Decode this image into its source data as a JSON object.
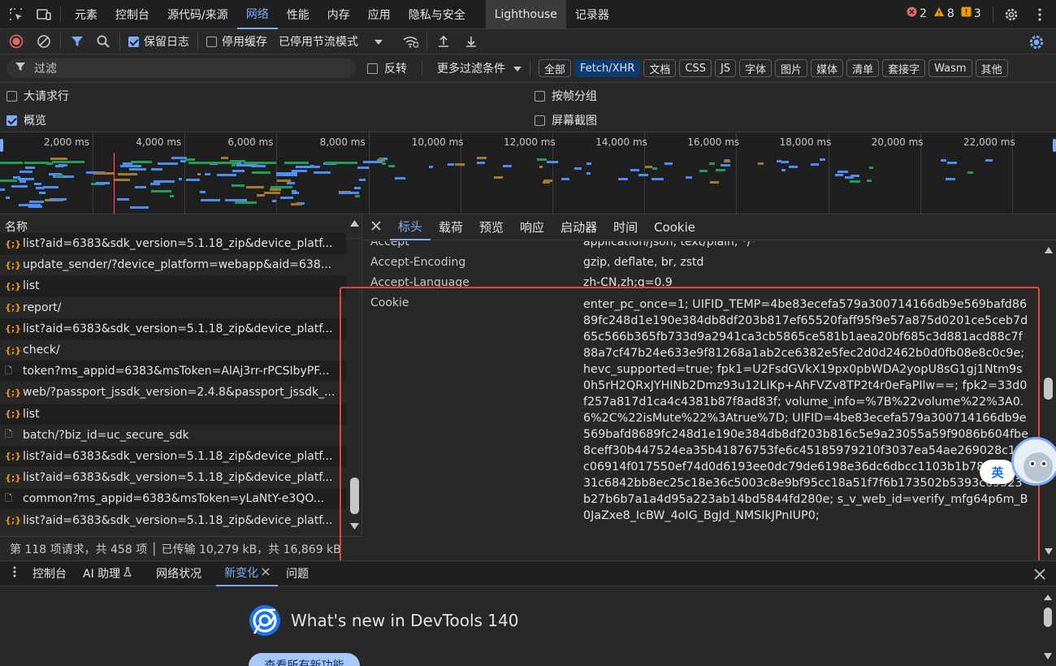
{
  "main_tabs": [
    {
      "label": "元素"
    },
    {
      "label": "控制台"
    },
    {
      "label": "源代码/来源"
    },
    {
      "label": "网络",
      "active": true
    },
    {
      "label": "性能"
    },
    {
      "label": "内存"
    },
    {
      "label": "应用"
    },
    {
      "label": "隐私与安全"
    },
    {
      "label": "Lighthouse"
    },
    {
      "label": "记录器"
    }
  ],
  "badges": {
    "errors": "2",
    "warnings": "8",
    "info": "3"
  },
  "toolbar": {
    "preserve_log": "保留日志",
    "disable_cache": "停用缓存",
    "throttle": "已停用节流模式"
  },
  "filter": {
    "placeholder": "过滤",
    "invert": "反转",
    "more_filters": "更多过滤条件",
    "types": [
      "全部",
      "Fetch/XHR",
      "文档",
      "CSS",
      "JS",
      "字体",
      "图片",
      "媒体",
      "清单",
      "套接字",
      "Wasm",
      "其他"
    ],
    "active_type": "Fetch/XHR"
  },
  "options": {
    "big_rows": "大请求行",
    "overview": "概览",
    "group_by_frame": "按帧分组",
    "screenshots": "屏幕截图"
  },
  "overview": {
    "ticks": [
      "2,000 ms",
      "4,000 ms",
      "6,000 ms",
      "8,000 ms",
      "10,000 ms",
      "12,000 ms",
      "14,000 ms",
      "16,000 ms",
      "18,000 ms",
      "20,000 ms",
      "22,000 ms"
    ]
  },
  "request_list": {
    "header": "名称",
    "rows": [
      {
        "type": "xhr",
        "name": "list?aid=6383&sdk_version=5.1.18_zip&device_platf..."
      },
      {
        "type": "xhr",
        "name": "update_sender/?device_platform=webapp&aid=638..."
      },
      {
        "type": "xhr",
        "name": "list"
      },
      {
        "type": "xhr",
        "name": "report/"
      },
      {
        "type": "xhr",
        "name": "list?aid=6383&sdk_version=5.1.18_zip&device_platf..."
      },
      {
        "type": "xhr",
        "name": "check/"
      },
      {
        "type": "doc",
        "name": "token?ms_appid=6383&msToken=AlAj3rr-rPCSIbyPF..."
      },
      {
        "type": "xhr",
        "name": "web/?passport_jssdk_version=2.4.8&passport_jssdk_..."
      },
      {
        "type": "xhr",
        "name": "list"
      },
      {
        "type": "doc",
        "name": "batch/?biz_id=uc_secure_sdk"
      },
      {
        "type": "xhr",
        "name": "list?aid=6383&sdk_version=5.1.18_zip&device_platf..."
      },
      {
        "type": "xhr",
        "name": "list?aid=6383&sdk_version=5.1.18_zip&device_platf..."
      },
      {
        "type": "doc",
        "name": "common?ms_appid=6383&msToken=yLaNtY-e3QO..."
      },
      {
        "type": "xhr",
        "name": "list?aid=6383&sdk_version=5.1.18_zip&device_platf..."
      }
    ]
  },
  "status_bar": "第 118 项请求，共 458 项 │ 已传输 10,279 kB，共 16,869 kB",
  "details": {
    "tabs": [
      "标头",
      "载荷",
      "预览",
      "响应",
      "启动器",
      "时间",
      "Cookie"
    ],
    "active_tab": "标头",
    "headers": [
      {
        "name": "Accept",
        "value": "application/json, text/plain, */*"
      },
      {
        "name": "Accept-Encoding",
        "value": "gzip, deflate, br, zstd"
      },
      {
        "name": "Accept-Language",
        "value": "zh-CN,zh;q=0.9"
      },
      {
        "name": "Cookie",
        "value": "enter_pc_once=1; UIFID_TEMP=4be83ecefa579a300714166db9e569bafd8689fc248d1e190e384db8df203b817ef65520faff95f9e57a875d0201ce5ceb7d65c566b365fb733d9a2941ca3cb5865ce581b1aea20bf685c3d881acd88c7f88a7cf47b24e633e9f81268a1ab2ce6382e5fec2d0d2462b0d0fb08e8c0c9e; hevc_supported=true; fpk1=U2FsdGVkX19px0pbWDA2yopU8sG1gj1Ntm9s0h5rH2QRxJYHINb2Dmz93u12LIKp+AhFVZv8TP2t4r0eFaPIlw==; fpk2=33d0f257a817d1ca4c4381b87f8ad83f; volume_info=%7B%22volume%22%3A0.6%2C%22isMute%22%3Atrue%7D; UIFID=4be83ecefa579a300714166db9e569bafd8689fc248d1e190e384db8df203b816c5e9a23055a59f9086b604fbe8ceff30b447524ea35b41876753fe6c45185979210f3037ea54ae269028c15c06914f017550ef74d0d6193ee0dc79de6198e36dc6dbcc1103b1b78b14a5b31c6842bb8ec25c18e36c5003c8e9bf95cc18a51f7f6b173502b5393c69523b27b6b7a1a4d95a223ab14bd5844fd280e; s_v_web_id=verify_mfg64p6m_B0JaZxe8_IcBW_4oIG_BgJd_NMSIkJPnIUP0;"
      }
    ]
  },
  "drawer": {
    "tabs": [
      "控制台",
      "AI 助理",
      "网络状况",
      "新变化",
      "问题"
    ],
    "active_tab": "新变化",
    "whats_new_title": "What's new in DevTools 140",
    "see_all": "查看所有新功能"
  },
  "ime_label": "英",
  "colors": {
    "accent": "#7cacf8",
    "error": "#e46962",
    "warning": "#f29900",
    "highlight_box": "#e5453e"
  }
}
